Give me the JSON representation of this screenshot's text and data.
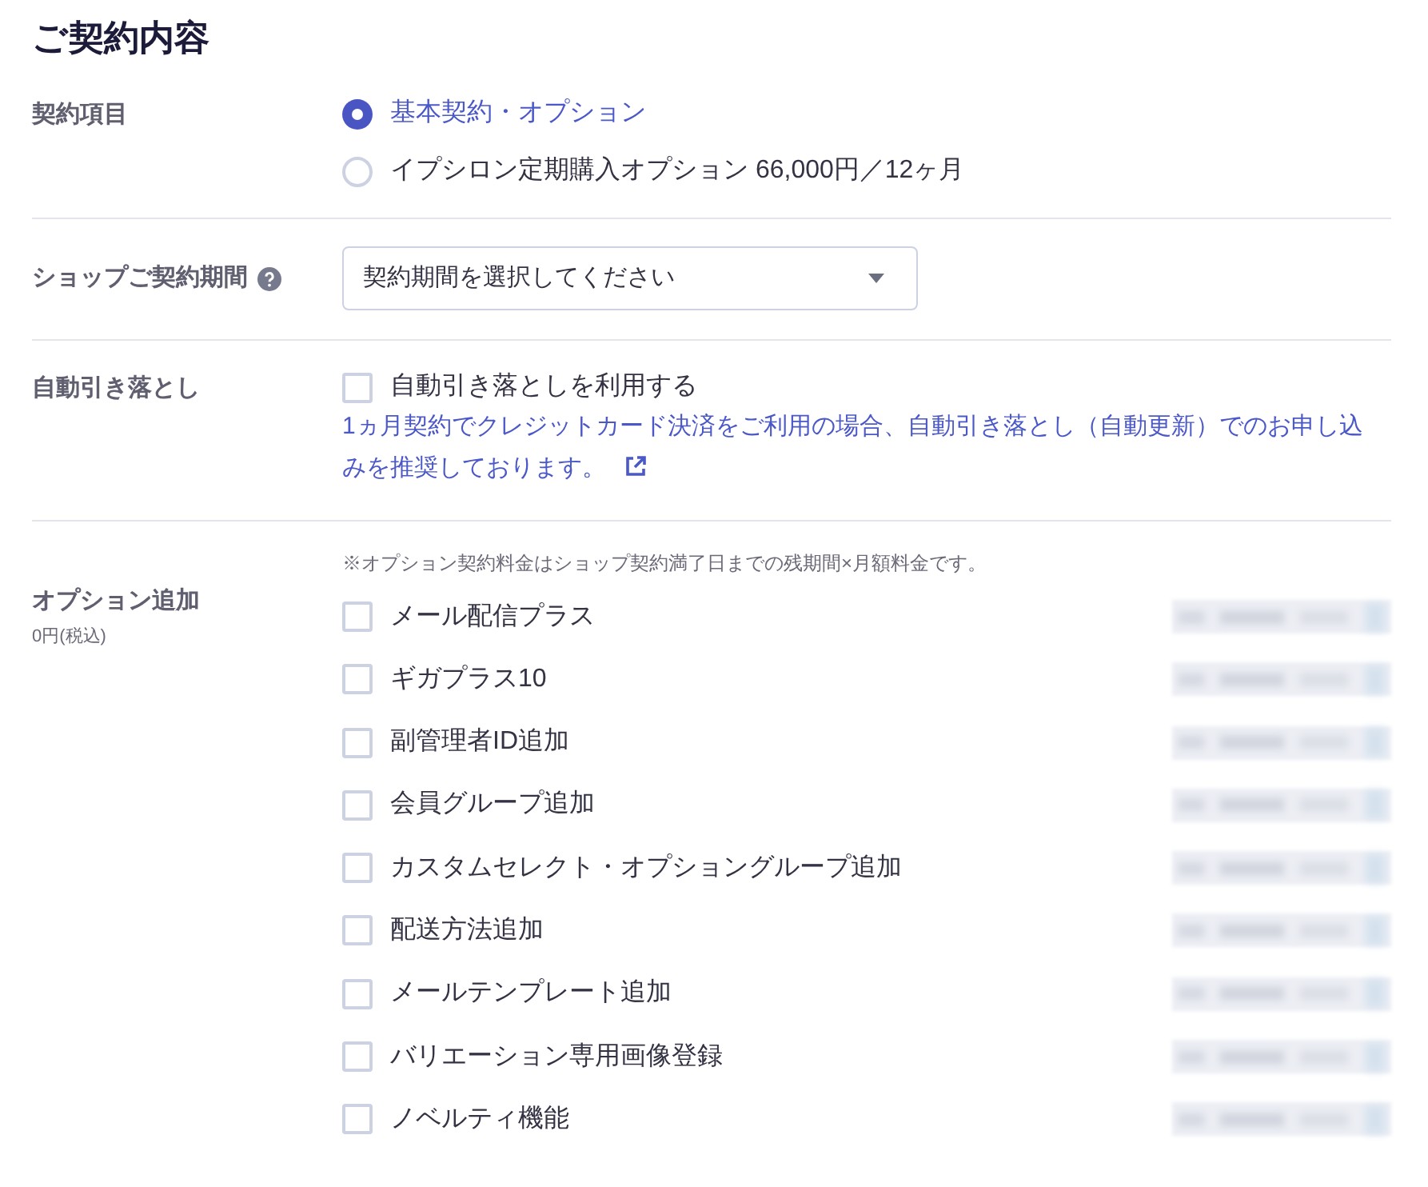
{
  "title": "ご契約内容",
  "sections": [
    {
      "kind": "radio",
      "label": "契約項目",
      "options": [
        {
          "label": "基本契約・オプション",
          "selected": true
        },
        {
          "label": "イプシロン定期購入オプション 66,000円／12ヶ月",
          "selected": false
        }
      ]
    },
    {
      "kind": "select",
      "label": "ショップご契約期間",
      "has_help": true,
      "placeholder": "契約期間を選択してください"
    },
    {
      "kind": "checkbox",
      "label": "自動引き落とし",
      "checkbox": {
        "label": "自動引き落としを利用する",
        "checked": false
      },
      "note": "1ヵ月契約でクレジットカード決済をご利用の場合、自動引き落とし（自動更新）でのお申し込みを推奨しております。",
      "note_link": true
    },
    {
      "kind": "options",
      "label": "オプション追加",
      "sublabel": "0円(税込)",
      "note": "※オプション契約料金はショップ契約満了日までの残期間×月額料金です。",
      "items": [
        {
          "label": "メール配信プラス",
          "checked": false
        },
        {
          "label": "ギガプラス10",
          "checked": false
        },
        {
          "label": "副管理者ID追加",
          "checked": false
        },
        {
          "label": "会員グループ追加",
          "checked": false
        },
        {
          "label": "カスタムセレクト・オプショングループ追加",
          "checked": false
        },
        {
          "label": "配送方法追加",
          "checked": false
        },
        {
          "label": "メールテンプレート追加",
          "checked": false
        },
        {
          "label": "バリエーション専用画像登録",
          "checked": false
        },
        {
          "label": "ノベルティ機能",
          "checked": false
        }
      ]
    }
  ]
}
